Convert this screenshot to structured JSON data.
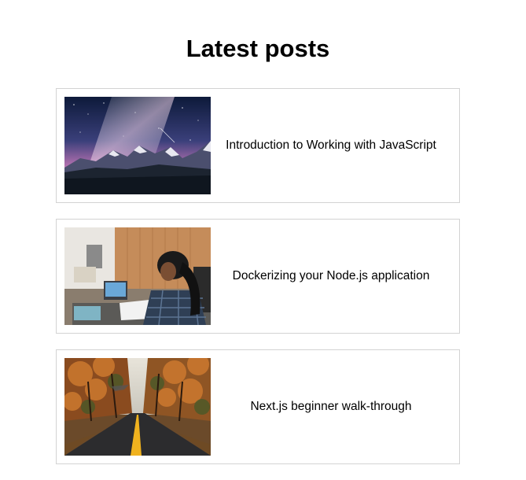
{
  "page": {
    "title": "Latest posts"
  },
  "posts": [
    {
      "title": "Introduction to Working with JavaScript",
      "image": "mountain-night-sky-image"
    },
    {
      "title": "Dockerizing your Node.js application",
      "image": "person-working-on-laptop-image"
    },
    {
      "title": "Next.js beginner walk-through",
      "image": "autumn-forest-road-image"
    }
  ]
}
